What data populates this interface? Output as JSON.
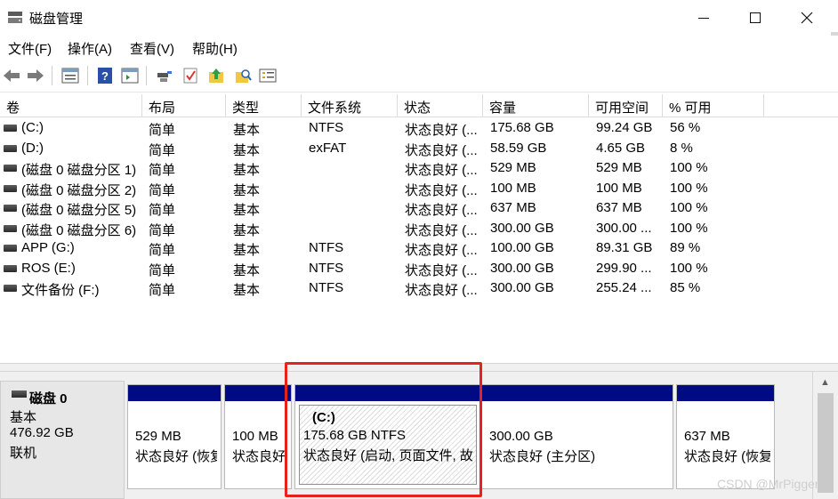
{
  "window": {
    "title": "磁盘管理"
  },
  "menu": [
    "文件(F)",
    "操作(A)",
    "查看(V)",
    "帮助(H)"
  ],
  "toolbar": {
    "icons": [
      "back-arrow-icon",
      "forward-arrow-icon",
      "properties-list-icon",
      "help-icon",
      "console-view-icon",
      "connect-icon",
      "check-icon",
      "folder-up-icon",
      "search-folder-icon",
      "list-view-icon"
    ]
  },
  "table": {
    "columns": [
      "卷",
      "布局",
      "类型",
      "文件系统",
      "状态",
      "容量",
      "可用空间",
      "% 可用"
    ],
    "rows": [
      [
        "(C:)",
        "简单",
        "基本",
        "NTFS",
        "状态良好 (...",
        "175.68 GB",
        "99.24 GB",
        "56 %"
      ],
      [
        "(D:)",
        "简单",
        "基本",
        "exFAT",
        "状态良好 (...",
        "58.59 GB",
        "4.65 GB",
        "8 %"
      ],
      [
        "(磁盘 0 磁盘分区 1)",
        "简单",
        "基本",
        "",
        "状态良好 (...",
        "529 MB",
        "529 MB",
        "100 %"
      ],
      [
        "(磁盘 0 磁盘分区 2)",
        "简单",
        "基本",
        "",
        "状态良好 (...",
        "100 MB",
        "100 MB",
        "100 %"
      ],
      [
        "(磁盘 0 磁盘分区 5)",
        "简单",
        "基本",
        "",
        "状态良好 (...",
        "637 MB",
        "637 MB",
        "100 %"
      ],
      [
        "(磁盘 0 磁盘分区 6)",
        "简单",
        "基本",
        "",
        "状态良好 (...",
        "300.00 GB",
        "300.00 ...",
        "100 %"
      ],
      [
        "APP (G:)",
        "简单",
        "基本",
        "NTFS",
        "状态良好 (...",
        "100.00 GB",
        "89.31 GB",
        "89 %"
      ],
      [
        "ROS (E:)",
        "简单",
        "基本",
        "NTFS",
        "状态良好 (...",
        "300.00 GB",
        "299.90 ...",
        "100 %"
      ],
      [
        "文件备份 (F:)",
        "简单",
        "基本",
        "NTFS",
        "状态良好 (...",
        "300.00 GB",
        "255.24 ...",
        "85 %"
      ]
    ]
  },
  "disk": {
    "name": "磁盘 0",
    "type": "基本",
    "size": "476.92 GB",
    "status": "联机"
  },
  "partitions": [
    {
      "label": "",
      "size": "529 MB",
      "status": "状态良好 (恢复"
    },
    {
      "label": "",
      "size": "100 MB",
      "status": "状态良好 (E"
    },
    {
      "label": "(C:)",
      "size": "175.68 GB NTFS",
      "status": "状态良好 (启动, 页面文件, 故"
    },
    {
      "label": "",
      "size": "300.00 GB",
      "status": "状态良好 (主分区)"
    },
    {
      "label": "",
      "size": "637 MB",
      "status": "状态良好 (恢复"
    }
  ],
  "watermark": "CSDN @MrPigger",
  "colors": {
    "partition_bar": "#000a84",
    "highlight": "#e5231c"
  }
}
